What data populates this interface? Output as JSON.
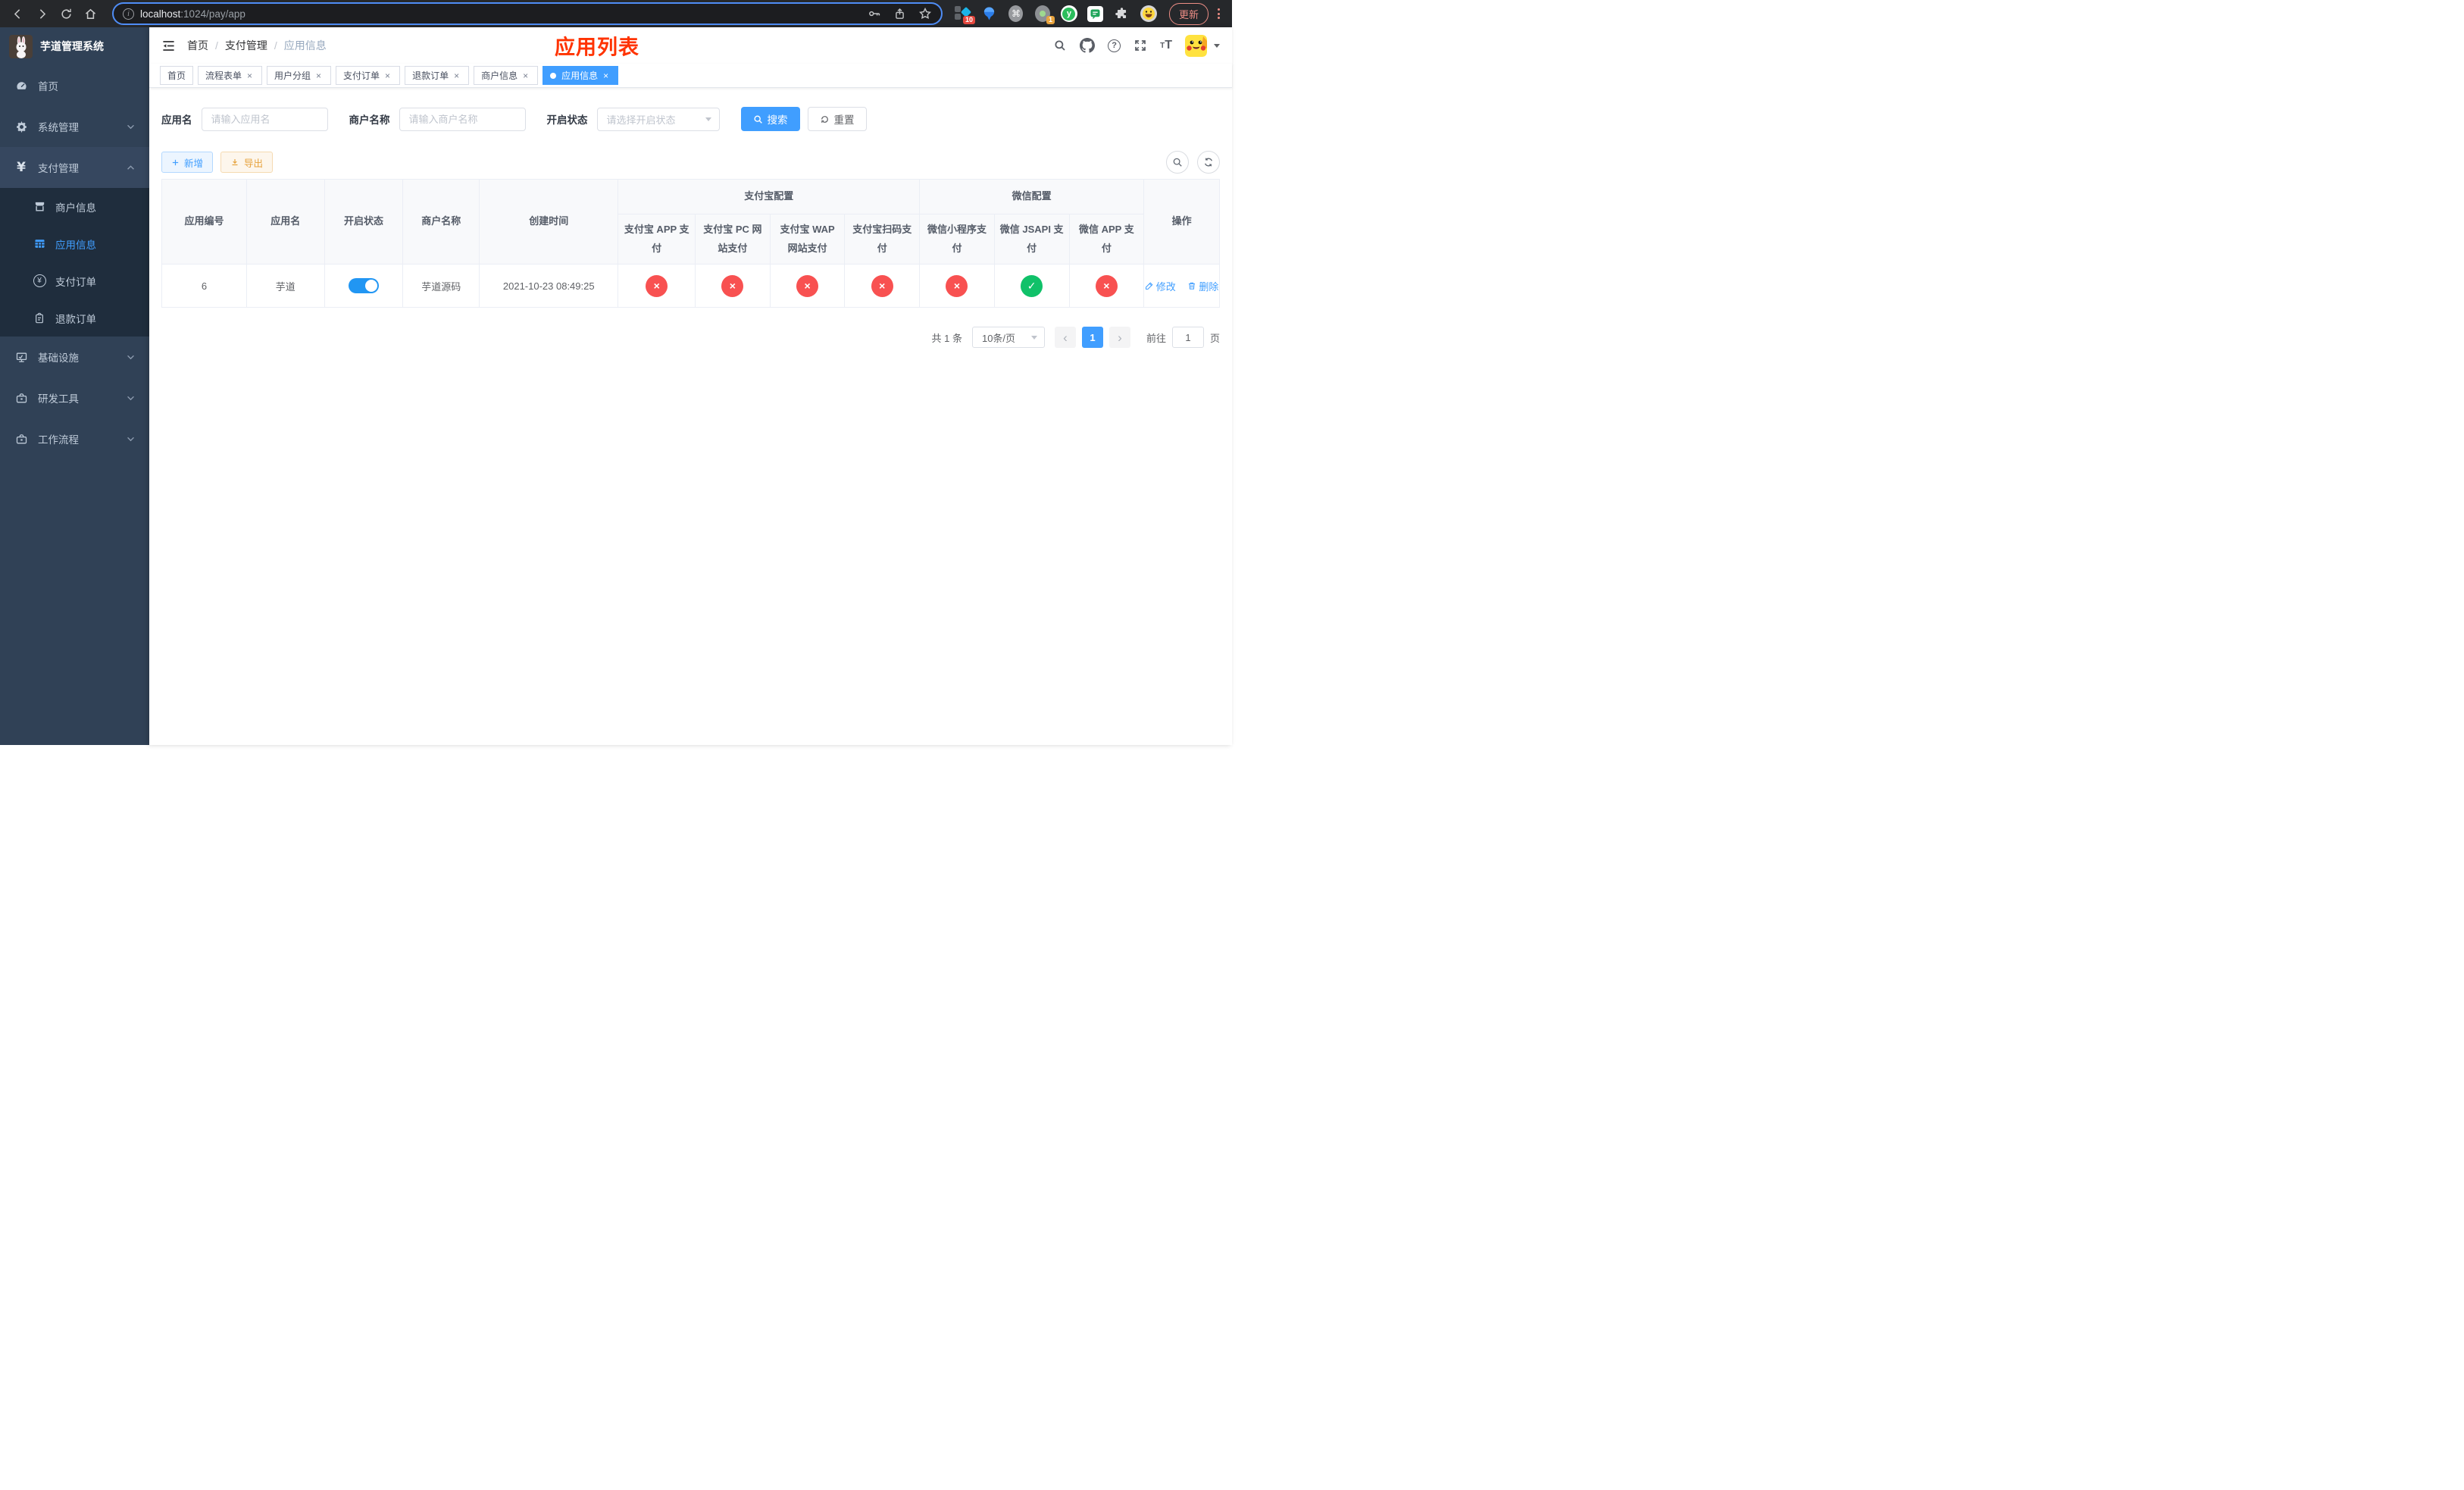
{
  "colors": {
    "accent": "#409eff",
    "title_red": "#ff3300",
    "danger": "#f85151",
    "success": "#10c169",
    "warning": "#e6a23c",
    "sidebar_bg": "#304156",
    "submenu_bg": "#1f2d3d"
  },
  "browser": {
    "url": {
      "host": "localhost",
      "path": ":1024/pay/app"
    },
    "update_label": "更新",
    "badges": {
      "ext1": "10",
      "ext4": "1"
    }
  },
  "sidebar": {
    "logo_title": "芋道管理系统",
    "home": "首页",
    "system": "系统管理",
    "payment": "支付管理",
    "merchant_info": "商户信息",
    "app_info": "应用信息",
    "pay_order": "支付订单",
    "refund_order": "退款订单",
    "infra": "基础设施",
    "dev_tools": "研发工具",
    "workflow": "工作流程"
  },
  "header": {
    "breadcrumb": {
      "home": "首页",
      "section": "支付管理",
      "current": "应用信息"
    },
    "overlay_title": "应用列表"
  },
  "tabs": {
    "active_index": 6,
    "items": [
      {
        "label": "首页",
        "closable": false
      },
      {
        "label": "流程表单",
        "closable": true
      },
      {
        "label": "用户分组",
        "closable": true
      },
      {
        "label": "支付订单",
        "closable": true
      },
      {
        "label": "退款订单",
        "closable": true
      },
      {
        "label": "商户信息",
        "closable": true
      },
      {
        "label": "应用信息",
        "closable": true
      }
    ]
  },
  "filters": {
    "app_name_label": "应用名",
    "app_name_placeholder": "请输入应用名",
    "merchant_label": "商户名称",
    "merchant_placeholder": "请输入商户名称",
    "status_label": "开启状态",
    "status_placeholder": "请选择开启状态",
    "search_label": "搜索",
    "reset_label": "重置"
  },
  "toolbar": {
    "add_label": "新增",
    "export_label": "导出"
  },
  "table": {
    "glyphs": {
      "pass": "✓",
      "fail": "×"
    },
    "headers": {
      "app_id": "应用编号",
      "app_name": "应用名",
      "status": "开启状态",
      "merchant": "商户名称",
      "create_time": "创建时间",
      "alipay_group": "支付宝配置",
      "wechat_group": "微信配置",
      "ch0": "支付宝 APP 支付",
      "ch1": "支付宝 PC 网站支付",
      "ch2": "支付宝 WAP 网站支付",
      "ch3": "支付宝扫码支付",
      "ch4": "微信小程序支付",
      "ch5": "微信 JSAPI 支付",
      "ch6": "微信 APP 支付",
      "actions": "操作"
    },
    "row": {
      "app_id": "6",
      "app_name": "芋道",
      "enabled": true,
      "merchant": "芋道源码",
      "create_time": "2021-10-23 08:49:25",
      "channels": [
        "fail",
        "fail",
        "fail",
        "fail",
        "fail",
        "pass",
        "fail"
      ],
      "edit_label": "修改",
      "delete_label": "删除"
    }
  },
  "pagination": {
    "total": "共 1 条",
    "page_size": "10条/页",
    "current_page": "1",
    "goto_label": "前往",
    "goto_value": "1",
    "unit": "页"
  }
}
